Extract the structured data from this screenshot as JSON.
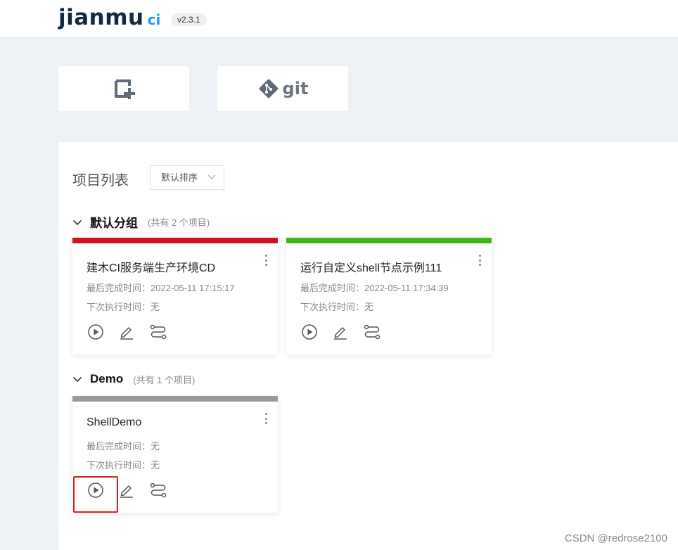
{
  "header": {
    "logo_text": "jianmu",
    "logo_suffix": "ci",
    "version": "v2.3.1"
  },
  "actions": {
    "add_icon": "add-square-icon",
    "git_label": "git"
  },
  "project_list": {
    "title": "项目列表",
    "sort_selected": "默认排序",
    "groups": [
      {
        "name": "默认分组",
        "count_text": "(共有 2 个项目)",
        "projects": [
          {
            "name": "建木CI服务端生产环境CD",
            "status_color": "#cf1322",
            "last_done": "最后完成时间：2022-05-11 17:15:17",
            "next_run": "下次执行时间：无"
          },
          {
            "name": "运行自定义shell节点示例111",
            "status_color": "#3cb81a",
            "last_done": "最后完成时间：2022-05-11 17:34:39",
            "next_run": "下次执行时间：无"
          }
        ]
      },
      {
        "name": "Demo",
        "count_text": "(共有 1 个项目)",
        "projects": [
          {
            "name": "ShellDemo",
            "status_color": "#9a9a9a",
            "last_done": "最后完成时间：无",
            "next_run": "下次执行时间：无"
          }
        ]
      }
    ]
  },
  "icons": {
    "run": "play-circle-icon",
    "edit": "pencil-icon",
    "pipeline": "pipeline-flow-icon",
    "more": "more-vertical-icon"
  },
  "colors": {
    "accent": "#1e9cf0",
    "highlight_box": "#e02020"
  },
  "watermark": "CSDN @redrose2100"
}
